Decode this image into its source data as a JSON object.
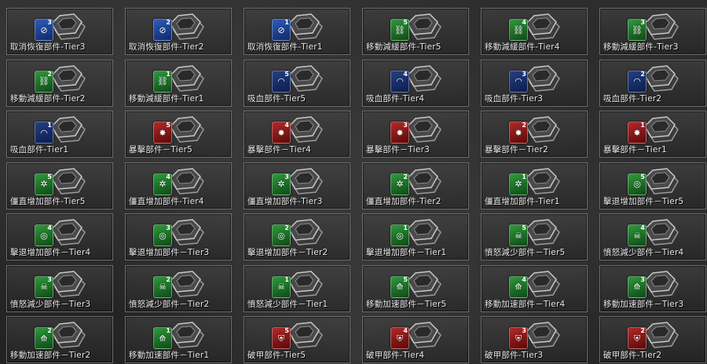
{
  "colors": {
    "blue": "#2f5bb8",
    "navy": "#223f86",
    "green": "#2e9a3c",
    "red": "#b52828"
  },
  "items": [
    {
      "label": "取消恢復部件-Tier3",
      "tier": "3",
      "color": "blue",
      "icon": "cancel-icon"
    },
    {
      "label": "取消恢復部件-Tier2",
      "tier": "2",
      "color": "blue",
      "icon": "cancel-icon"
    },
    {
      "label": "取消恢復部件-Tier1",
      "tier": "1",
      "color": "blue",
      "icon": "cancel-icon"
    },
    {
      "label": "移動減緩部件-Tier5",
      "tier": "5",
      "color": "green",
      "icon": "chain-icon"
    },
    {
      "label": "移動減緩部件-Tier4",
      "tier": "4",
      "color": "green",
      "icon": "chain-icon"
    },
    {
      "label": "移動減緩部件-Tier3",
      "tier": "3",
      "color": "green",
      "icon": "chain-icon"
    },
    {
      "label": "移動減緩部件-Tier2",
      "tier": "2",
      "color": "green",
      "icon": "chain-icon"
    },
    {
      "label": "移動減緩部件-Tier1",
      "tier": "1",
      "color": "green",
      "icon": "chain-icon"
    },
    {
      "label": "吸血部件-Tier5",
      "tier": "5",
      "color": "navy",
      "icon": "fang-icon"
    },
    {
      "label": "吸血部件-Tier4",
      "tier": "4",
      "color": "navy",
      "icon": "fang-icon"
    },
    {
      "label": "吸血部件-Tier3",
      "tier": "3",
      "color": "navy",
      "icon": "fang-icon"
    },
    {
      "label": "吸血部件-Tier2",
      "tier": "2",
      "color": "navy",
      "icon": "fang-icon"
    },
    {
      "label": "吸血部件-Tier1",
      "tier": "1",
      "color": "navy",
      "icon": "fang-icon"
    },
    {
      "label": "暴擊部件－Tier5",
      "tier": "5",
      "color": "red",
      "icon": "burst-icon"
    },
    {
      "label": "暴擊部件－Tier4",
      "tier": "4",
      "color": "red",
      "icon": "burst-icon"
    },
    {
      "label": "暴擊部件－Tier3",
      "tier": "3",
      "color": "red",
      "icon": "burst-icon"
    },
    {
      "label": "暴擊部件－Tier2",
      "tier": "2",
      "color": "red",
      "icon": "burst-icon"
    },
    {
      "label": "暴擊部件－Tier1",
      "tier": "1",
      "color": "red",
      "icon": "burst-icon"
    },
    {
      "label": "僵直增加部件-Tier5",
      "tier": "5",
      "color": "green",
      "icon": "sparkle-icon"
    },
    {
      "label": "僵直增加部件-Tier4",
      "tier": "4",
      "color": "green",
      "icon": "sparkle-icon"
    },
    {
      "label": "僵直增加部件-Tier3",
      "tier": "3",
      "color": "green",
      "icon": "sparkle-icon"
    },
    {
      "label": "僵直增加部件-Tier2",
      "tier": "2",
      "color": "green",
      "icon": "sparkle-icon"
    },
    {
      "label": "僵直增加部件-Tier1",
      "tier": "1",
      "color": "green",
      "icon": "sparkle-icon"
    },
    {
      "label": "擊退增加部件－Tier5",
      "tier": "5",
      "color": "green",
      "icon": "ring-icon"
    },
    {
      "label": "擊退增加部件－Tier4",
      "tier": "4",
      "color": "green",
      "icon": "ring-icon"
    },
    {
      "label": "擊退增加部件－Tier3",
      "tier": "3",
      "color": "green",
      "icon": "ring-icon"
    },
    {
      "label": "擊退增加部件－Tier2",
      "tier": "2",
      "color": "green",
      "icon": "ring-icon"
    },
    {
      "label": "擊退增加部件－Tier1",
      "tier": "1",
      "color": "green",
      "icon": "ring-icon"
    },
    {
      "label": "憤怒減少部件－Tier5",
      "tier": "5",
      "color": "green",
      "icon": "skull-icon"
    },
    {
      "label": "憤怒減少部件－Tier4",
      "tier": "4",
      "color": "green",
      "icon": "skull-icon"
    },
    {
      "label": "憤怒減少部件－Tier3",
      "tier": "3",
      "color": "green",
      "icon": "skull-icon"
    },
    {
      "label": "憤怒減少部件－Tier2",
      "tier": "2",
      "color": "green",
      "icon": "skull-icon"
    },
    {
      "label": "憤怒減少部件－Tier1",
      "tier": "1",
      "color": "green",
      "icon": "skull-icon"
    },
    {
      "label": "移動加速部件－Tier5",
      "tier": "5",
      "color": "green",
      "icon": "boot-icon"
    },
    {
      "label": "移動加速部件－Tier4",
      "tier": "4",
      "color": "green",
      "icon": "boot-icon"
    },
    {
      "label": "移動加速部件－Tier3",
      "tier": "3",
      "color": "green",
      "icon": "boot-icon"
    },
    {
      "label": "移動加速部件－Tier2",
      "tier": "2",
      "color": "green",
      "icon": "boot-icon"
    },
    {
      "label": "移動加速部件－Tier1",
      "tier": "1",
      "color": "green",
      "icon": "boot-icon"
    },
    {
      "label": "破甲部件-Tier5",
      "tier": "5",
      "color": "red",
      "icon": "shield-icon"
    },
    {
      "label": "破甲部件-Tier4",
      "tier": "4",
      "color": "red",
      "icon": "shield-icon"
    },
    {
      "label": "破甲部件-Tier3",
      "tier": "3",
      "color": "red",
      "icon": "shield-icon"
    },
    {
      "label": "破甲部件-Tier2",
      "tier": "2",
      "color": "red",
      "icon": "shield-icon"
    }
  ]
}
